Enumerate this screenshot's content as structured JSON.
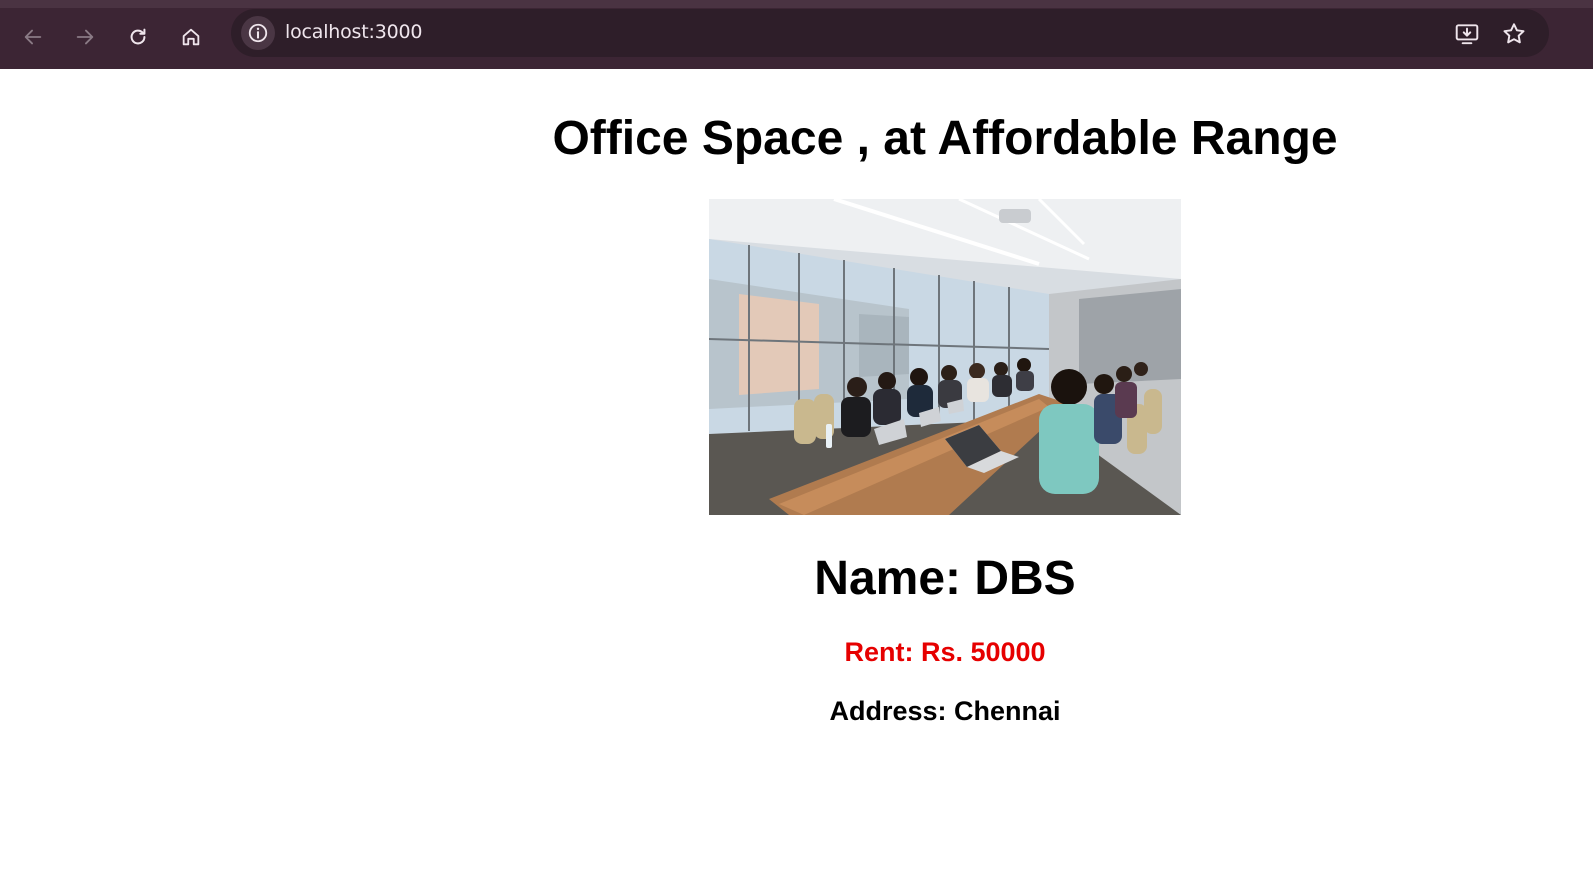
{
  "browser": {
    "url": "localhost:3000",
    "icons": {
      "back": "arrow-left-icon",
      "forward": "arrow-right-icon",
      "reload": "reload-icon",
      "home": "home-icon",
      "site_info": "info-icon",
      "install": "install-app-icon",
      "bookmark": "star-icon"
    }
  },
  "page": {
    "title": "Office Space , at Affordable Range",
    "image": "office-meeting-photo",
    "name": "Name: DBS",
    "rent": "Rent: Rs. 50000",
    "address": "Address: Chennai"
  },
  "colors": {
    "chrome": "#3c2534",
    "omnibox": "#2e1e29",
    "rent": "#e60000",
    "text": "#000000"
  }
}
